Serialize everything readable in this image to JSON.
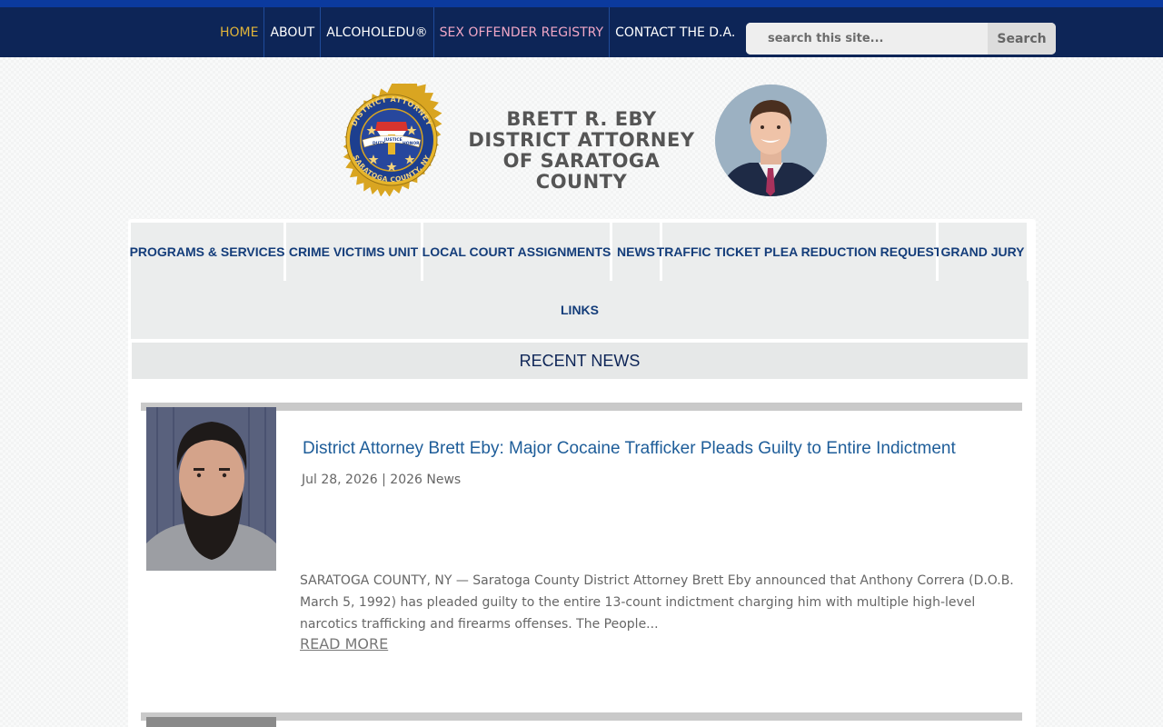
{
  "colors": {
    "accent_bar": "#0b3a9e",
    "topnav_bg": "#0d2557",
    "home_active": "#e0b43a",
    "registry_pink": "#f0a7c6",
    "mainnav_text": "#143d7a",
    "post_title": "#1e5d99"
  },
  "topnav": {
    "items": [
      {
        "label": "HOME",
        "color": "#e0b43a"
      },
      {
        "label": "ABOUT",
        "color": "#ffffff"
      },
      {
        "label": "ALCOHOLEDU®",
        "color": "#ffffff"
      },
      {
        "label": "SEX OFFENDER REGISTRY",
        "color": "#f0a7c6"
      },
      {
        "label": "CONTACT THE D.A.",
        "color": "#ffffff"
      }
    ],
    "search": {
      "placeholder": "search this site...",
      "button": "Search"
    }
  },
  "header": {
    "line1": "BRETT R. EBY",
    "line2": "DISTRICT ATTORNEY",
    "line3": "OF SARATOGA COUNTY",
    "seal": {
      "top": "DISTRICT ATTORNEY",
      "bottom": "SARATOGA COUNTY, NY",
      "banner_left": "DUTY",
      "banner_mid": "JUSTICE",
      "banner_right": "HONOR"
    }
  },
  "mainnav": {
    "row1": [
      "PROGRAMS & SERVICES",
      "CRIME VICTIMS UNIT",
      "LOCAL COURT ASSIGNMENTS",
      "NEWS",
      "TRAFFIC TICKET PLEA REDUCTION REQUEST",
      "GRAND JURY"
    ],
    "row2": "LINKS"
  },
  "recent_news": {
    "heading": "RECENT NEWS",
    "posts": [
      {
        "title": "District Attorney Brett Eby: Major Cocaine Trafficker Pleads Guilty to Entire Indictment",
        "meta": "Jul 28, 2026 | 2026 News",
        "excerpt": "SARATOGA COUNTY, NY — Saratoga County District Attorney Brett Eby announced that Anthony Correra (D.O.B. March 5, 1992) has pleaded guilty to the entire 13-count indictment charging him with multiple high-level narcotics trafficking and firearms offenses. The People...",
        "read_more": "READ MORE"
      }
    ]
  }
}
